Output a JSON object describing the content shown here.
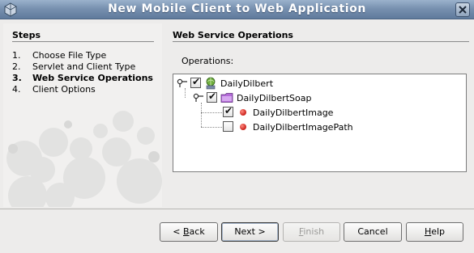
{
  "window": {
    "title": "New Mobile Client to Web Application",
    "close_glyph": "×"
  },
  "steps": {
    "header": "Steps",
    "items": [
      {
        "num": "1.",
        "label": "Choose File Type"
      },
      {
        "num": "2.",
        "label": "Servlet and Client Type"
      },
      {
        "num": "3.",
        "label": "Web Service Operations"
      },
      {
        "num": "4.",
        "label": "Client Options"
      }
    ],
    "active_index": 2
  },
  "content": {
    "header": "Web Service Operations",
    "operations_label_pre": "Operations",
    "operations_label_mnemonic": "",
    "operations_label_post": ":"
  },
  "tree": {
    "root": {
      "label": "DailyDilbert",
      "checked": true,
      "icon": "web-service-icon"
    },
    "port": {
      "label": "DailyDilbertSoap",
      "checked": true,
      "icon": "folder-icon"
    },
    "operations": [
      {
        "label": "DailyDilbertImage",
        "checked": true,
        "icon": "operation-dot-icon"
      },
      {
        "label": "DailyDilbertImagePath",
        "checked": false,
        "icon": "operation-dot-icon"
      }
    ]
  },
  "buttons": {
    "back": {
      "pre": "< ",
      "mnemonic": "B",
      "post": "ack"
    },
    "next": "Next >",
    "finish": {
      "mnemonic": "F",
      "post": "inish"
    },
    "cancel": "Cancel",
    "help": {
      "mnemonic": "H",
      "post": "elp"
    }
  },
  "colors": {
    "titlebar": "#7891b0",
    "panel_bg": "#edeceb",
    "operation_dot": "#c9201a"
  }
}
